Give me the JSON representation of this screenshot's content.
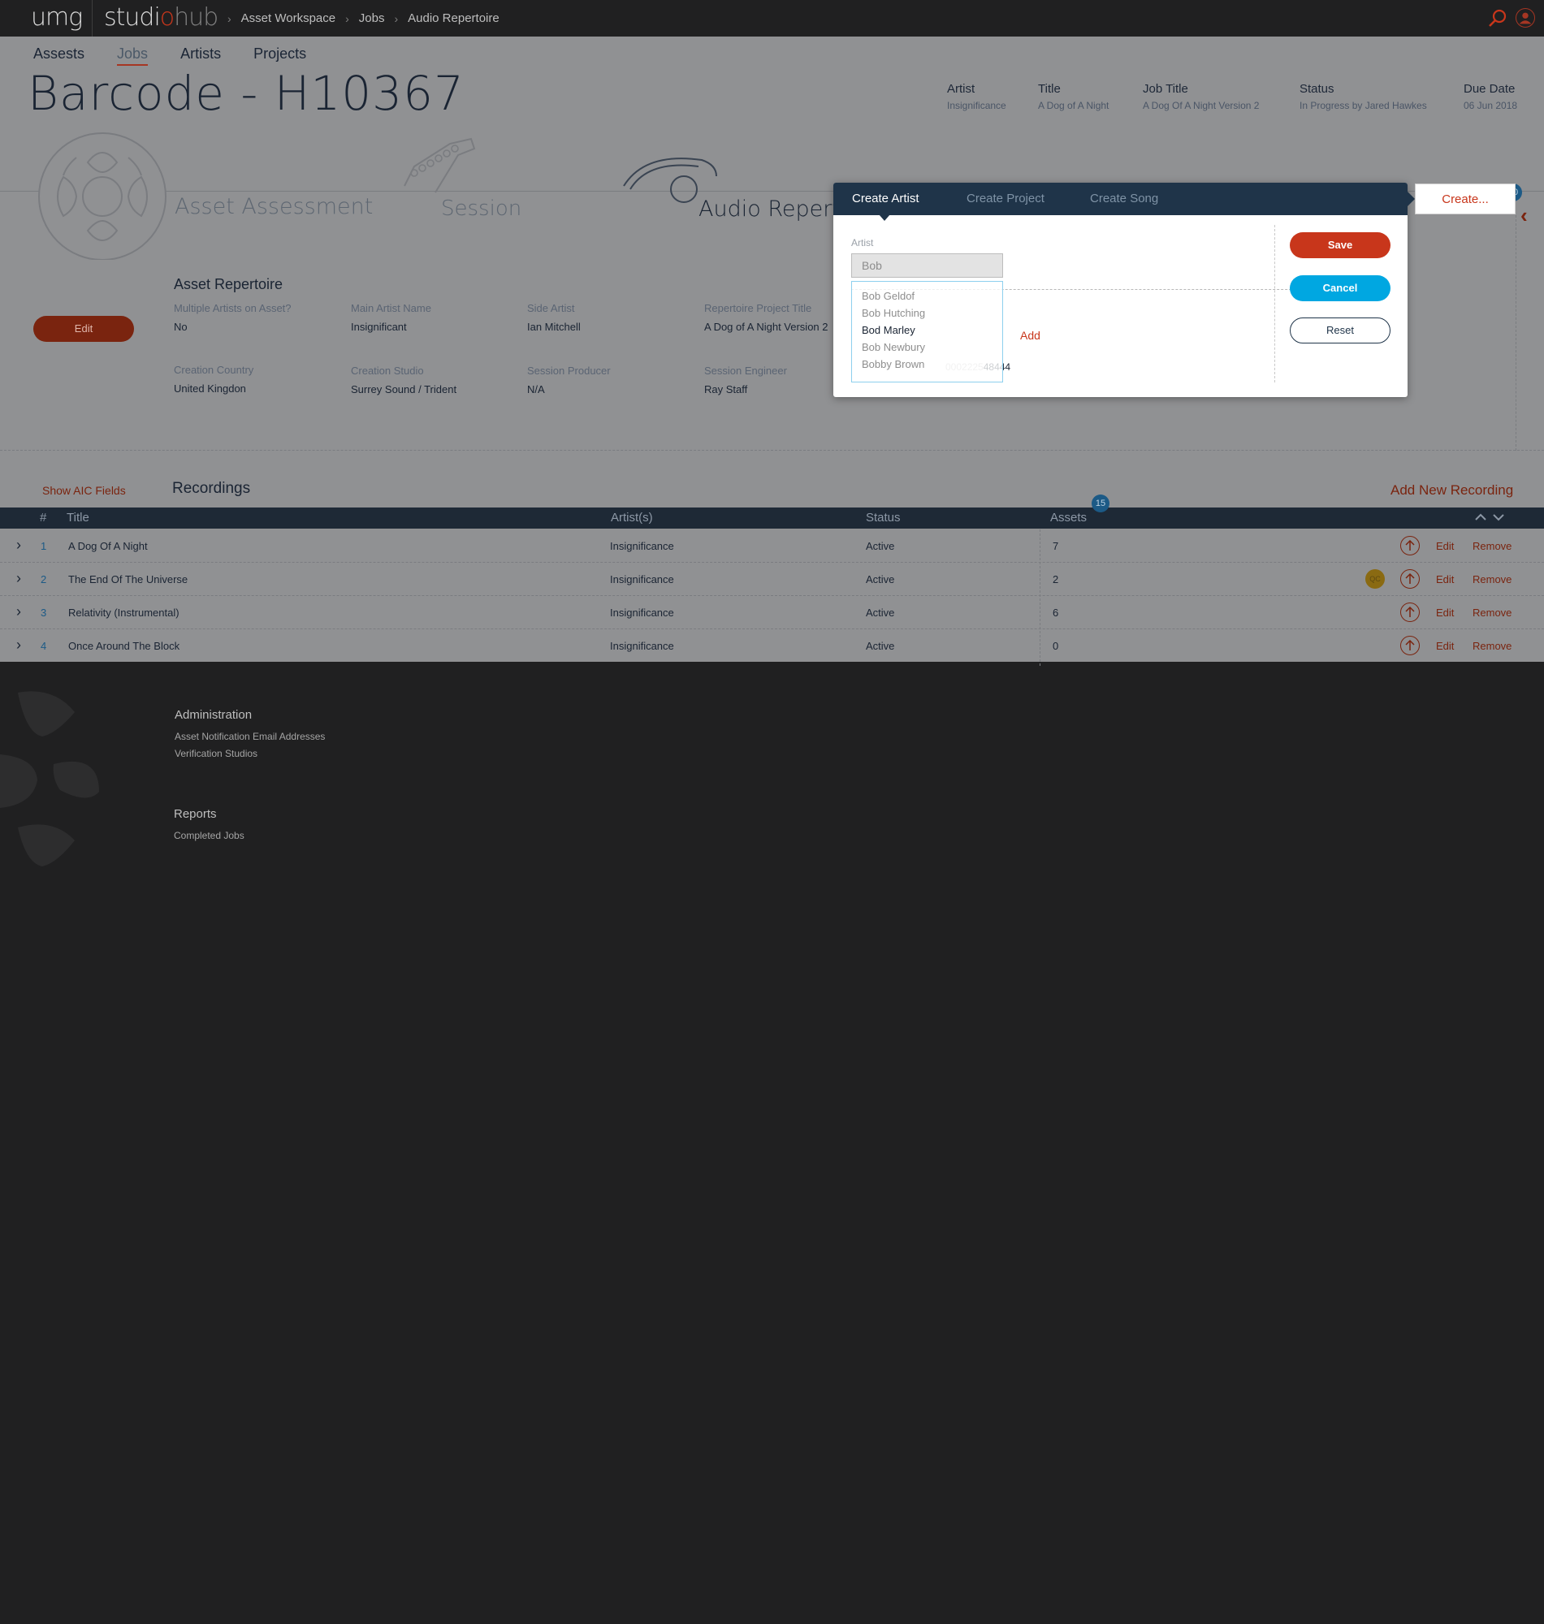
{
  "app": {
    "logo_left": "umg",
    "logo_studio_a": "studi",
    "logo_studio_o": "o",
    "logo_studio_b": "hub"
  },
  "breadcrumb": [
    "Asset Workspace",
    "Jobs",
    "Audio Repertoire"
  ],
  "mainnav": [
    "Assests",
    "Jobs",
    "Artists",
    "Projects"
  ],
  "page": {
    "title": "Barcode - H10367"
  },
  "meta": [
    {
      "label": "Artist",
      "value": "Insignificance"
    },
    {
      "label": "Title",
      "value": "A Dog of A Night"
    },
    {
      "label": "Job Title",
      "value": "A Dog Of A Night Version 2"
    },
    {
      "label": "Status",
      "value": "In Progress by Jared Hawkes"
    },
    {
      "label": "Due Date",
      "value": "06 Jun 2018"
    }
  ],
  "stages": {
    "asset_assessment": "Asset Assessment",
    "session": "Session",
    "audio_repertoire": "Audio Reperto"
  },
  "repertoire": {
    "title": "Asset Repertoire",
    "edit_label": "Edit",
    "fields": [
      {
        "label": "Multiple Artists on Asset?",
        "value": "No"
      },
      {
        "label": "Main Artist Name",
        "value": "Insignificant"
      },
      {
        "label": "Side Artist",
        "value": "Ian Mitchell"
      },
      {
        "label": "Repertoire Project Title",
        "value": "A Dog of A Night Version 2"
      },
      {
        "label": "Creation Country",
        "value": "United Kingdon"
      },
      {
        "label": "Creation Studio",
        "value": "Surrey Sound / Trident"
      },
      {
        "label": "Session Producer",
        "value": "N/A"
      },
      {
        "label": "Session Engineer",
        "value": "Ray Staff"
      }
    ]
  },
  "side_badge": "20",
  "recordings": {
    "show_aic": "Show AIC Fields",
    "title": "Recordings",
    "add_label": "Add New Recording",
    "assets_badge": "15",
    "columns": [
      "#",
      "Title",
      "Artist(s)",
      "Status",
      "Assets"
    ],
    "rows": [
      {
        "num": "1",
        "title": "A Dog Of A Night",
        "artist": "Insignificance",
        "status": "Active",
        "assets": "7",
        "qc": false
      },
      {
        "num": "2",
        "title": "The End Of The Universe",
        "artist": "Insignificance",
        "status": "Active",
        "assets": "2",
        "qc": true
      },
      {
        "num": "3",
        "title": "Relativity (Instrumental)",
        "artist": "Insignificance",
        "status": "Active",
        "assets": "6",
        "qc": false
      },
      {
        "num": "4",
        "title": "Once Around The Block",
        "artist": "Insignificance",
        "status": "Active",
        "assets": "0",
        "qc": false
      }
    ],
    "edit_label": "Edit",
    "remove_label": "Remove",
    "qc_label": "QC"
  },
  "footer": {
    "admin_title": "Administration",
    "admin_links": [
      "Asset Notification Email Addresses",
      "Verification Studios"
    ],
    "reports_title": "Reports",
    "reports_links": [
      "Completed Jobs"
    ]
  },
  "modal": {
    "create_button": "Create...",
    "tabs": [
      "Create Artist",
      "Create Project",
      "Create Song"
    ],
    "artist_label": "Artist",
    "artist_value": "Bob",
    "suggestions": [
      "Bob Geldof",
      "Bob Hutching",
      "Bod Marley",
      "Bob Newbury",
      "Bobby Brown"
    ],
    "highlighted": "Bod Marley",
    "add_label": "Add",
    "ghost_faded": "0002225",
    "ghost_visible": "48444",
    "save": "Save",
    "cancel": "Cancel",
    "reset": "Reset"
  },
  "colors": {
    "accent": "#c8361b",
    "navy": "#1f3449",
    "cyan": "#00a7e1",
    "badge": "#1c5a86"
  }
}
